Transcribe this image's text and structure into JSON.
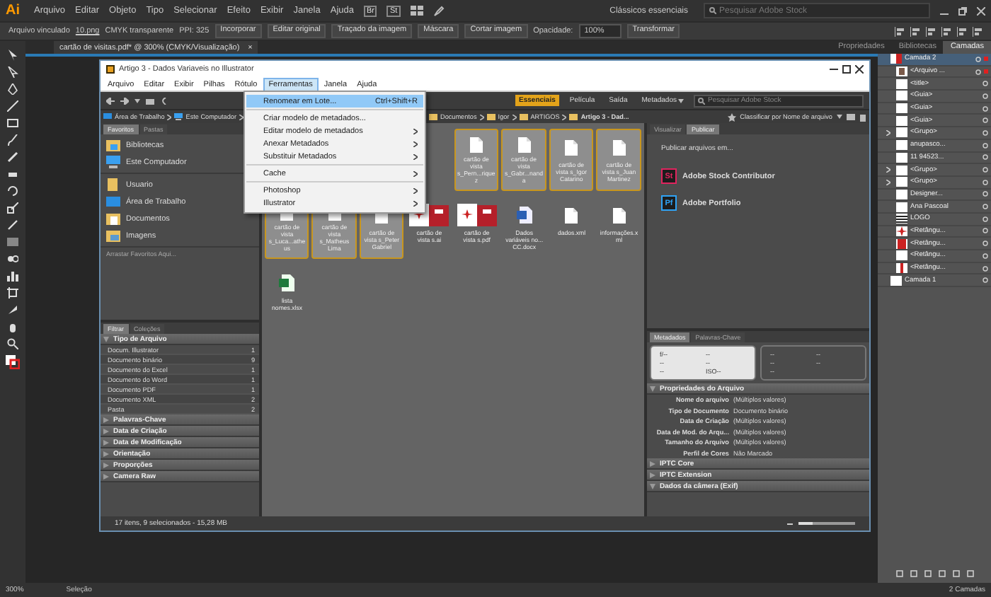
{
  "app": {
    "logo": "Ai",
    "menu": [
      "Arquivo",
      "Editar",
      "Objeto",
      "Tipo",
      "Selecionar",
      "Efeito",
      "Exibir",
      "Janela",
      "Ajuda"
    ],
    "badges": [
      "Br",
      "St"
    ],
    "workspace": "Clássicos essenciais",
    "search_placeholder": "Pesquisar Adobe Stock"
  },
  "control_bar": [
    {
      "kind": "label",
      "text": "Arquivo vinculado"
    },
    {
      "kind": "link",
      "text": "10.png"
    },
    {
      "kind": "label",
      "text": "CMYK transparente"
    },
    {
      "kind": "label",
      "text": "PPI: 325"
    },
    {
      "kind": "button",
      "text": "Incorporar"
    },
    {
      "kind": "button",
      "text": "Editar original"
    },
    {
      "kind": "dropdown",
      "text": "Traçado da imagem"
    },
    {
      "kind": "button",
      "text": "Máscara"
    },
    {
      "kind": "button",
      "text": "Cortar imagem"
    },
    {
      "kind": "label",
      "text": "Opacidade:"
    },
    {
      "kind": "field",
      "text": "100%"
    },
    {
      "kind": "button",
      "text": "Transformar"
    }
  ],
  "document_tab": {
    "title": "cartão de visitas.pdf* @ 300% (CMYK/Visualização)",
    "close": "×"
  },
  "panel_tabs": [
    {
      "label": "Propriedades",
      "selected": false
    },
    {
      "label": "Bibliotecas",
      "selected": false
    },
    {
      "label": "Camadas",
      "selected": true
    }
  ],
  "layers": [
    {
      "name": "Camada 2",
      "kind": "card",
      "selected": true,
      "selected_art": true,
      "children": [
        {
          "name": "<Arquivo ...",
          "kind": "photo",
          "expandable": false,
          "selected_art": true
        },
        {
          "name": "<title>",
          "kind": "blank",
          "expandable": false,
          "selected_art": false
        },
        {
          "name": "<Guia>",
          "kind": "blank",
          "expandable": false,
          "selected_art": false
        },
        {
          "name": "<Guia>",
          "kind": "blank",
          "expandable": false,
          "selected_art": false
        },
        {
          "name": "<Guia>",
          "kind": "blank",
          "expandable": false,
          "selected_art": false
        },
        {
          "name": "<Grupo>",
          "kind": "blank",
          "expandable": true,
          "selected_art": false
        },
        {
          "name": "anupasco...",
          "kind": "blank",
          "expandable": false,
          "selected_art": false
        },
        {
          "name": "11 94523...",
          "kind": "blank",
          "expandable": false,
          "selected_art": false
        },
        {
          "name": "<Grupo>",
          "kind": "blank",
          "expandable": true,
          "selected_art": false
        },
        {
          "name": "<Grupo>",
          "kind": "blank",
          "expandable": true,
          "selected_art": false
        },
        {
          "name": "Designer...",
          "kind": "blank",
          "expandable": false,
          "selected_art": false
        },
        {
          "name": "Ana Pascoal",
          "kind": "blank",
          "expandable": false,
          "selected_art": false
        },
        {
          "name": "LOGO",
          "kind": "lines",
          "expandable": false,
          "selected_art": false
        },
        {
          "name": "<Retângu...",
          "kind": "star",
          "expandable": false,
          "selected_art": false
        },
        {
          "name": "<Retângu...",
          "kind": "bar",
          "expandable": false,
          "selected_art": false
        },
        {
          "name": "<Retângu...",
          "kind": "blank",
          "expandable": false,
          "selected_art": false
        },
        {
          "name": "<Retângu...",
          "kind": "stripe",
          "expandable": false,
          "selected_art": false
        }
      ]
    },
    {
      "name": "Camada 1",
      "kind": "blank",
      "selected": false,
      "selected_art": false
    }
  ],
  "bridge": {
    "title": "Artigo 3 - Dados Variaveis no Illustrator",
    "menu": [
      {
        "label": "Arquivo",
        "selected": false
      },
      {
        "label": "Editar",
        "selected": false
      },
      {
        "label": "Exibir",
        "selected": false
      },
      {
        "label": "Pilhas",
        "selected": false
      },
      {
        "label": "Rótulo",
        "selected": false
      },
      {
        "label": "Ferramentas",
        "selected": true
      },
      {
        "label": "Janela",
        "selected": false
      },
      {
        "label": "Ajuda",
        "selected": false
      }
    ],
    "dropdown": [
      [
        {
          "label": "Renomear em Lote...",
          "shortcut": "Ctrl+Shift+R",
          "submenu": false,
          "highlighted": true
        }
      ],
      [
        {
          "label": "Criar modelo de metadados...",
          "submenu": false,
          "highlighted": false
        },
        {
          "label": "Editar modelo de metadados",
          "submenu": true,
          "highlighted": false
        },
        {
          "label": "Anexar Metadados",
          "submenu": true,
          "highlighted": false
        },
        {
          "label": "Substituir Metadados",
          "submenu": true,
          "highlighted": false
        }
      ],
      [
        {
          "label": "Cache",
          "submenu": true,
          "highlighted": false
        }
      ],
      [
        {
          "label": "Photoshop",
          "submenu": true,
          "highlighted": false
        },
        {
          "label": "Illustrator",
          "submenu": true,
          "highlighted": false
        }
      ]
    ],
    "workspaces": [
      {
        "label": "Essenciais",
        "selected": true
      },
      {
        "label": "Película",
        "selected": false
      },
      {
        "label": "Saída",
        "selected": false
      },
      {
        "label": "Metadados",
        "selected": false
      }
    ],
    "search_placeholder": "Pesquisar Adobe Stock",
    "path_start": [
      "Área de Trabalho",
      "Este Computador"
    ],
    "path_end": [
      "Documentos",
      "Igor",
      "ARTIGOS",
      "Artigo 3 - Dad..."
    ],
    "sort": "Classificar por Nome de arquivo",
    "favorites_tabs": [
      {
        "label": "Favoritos",
        "selected": true
      },
      {
        "label": "Pastas",
        "selected": false
      }
    ],
    "favorites": [
      [
        {
          "label": "Bibliotecas",
          "kind": "library"
        },
        {
          "label": "Este Computador",
          "kind": "computer"
        }
      ],
      [
        {
          "label": "Usuario",
          "kind": "folder"
        },
        {
          "label": "Área de Trabalho",
          "kind": "desktop"
        },
        {
          "label": "Documentos",
          "kind": "documents"
        },
        {
          "label": "Imagens",
          "kind": "images"
        }
      ]
    ],
    "favorites_hint": "Arrastar Favoritos Aqui...",
    "filter_tabs": [
      {
        "label": "Filtrar",
        "selected": true
      },
      {
        "label": "Coleções",
        "selected": false
      }
    ],
    "filters": [
      {
        "title": "Tipo de Arquivo",
        "expanded": true,
        "rows": [
          {
            "label": "Docum. Illustrator",
            "count": "1"
          },
          {
            "label": "Documento binário",
            "count": "9"
          },
          {
            "label": "Documento do Excel",
            "count": "1"
          },
          {
            "label": "Documento do Word",
            "count": "1"
          },
          {
            "label": "Documento PDF",
            "count": "1"
          },
          {
            "label": "Documento XML",
            "count": "2"
          },
          {
            "label": "Pasta",
            "count": "2"
          }
        ]
      },
      {
        "title": "Palavras-Chave",
        "expanded": false
      },
      {
        "title": "Data de Criação",
        "expanded": false
      },
      {
        "title": "Data de Modificação",
        "expanded": false
      },
      {
        "title": "Orientação",
        "expanded": false
      },
      {
        "title": "Proporções",
        "expanded": false
      },
      {
        "title": "Camera Raw",
        "expanded": false
      }
    ],
    "file_rows": [
      [
        {
          "label": "cartão de vista s_Pern...riquez",
          "kind": "document",
          "selected": true
        },
        {
          "label": "cartão de vista s_Gabr...nanda",
          "kind": "document",
          "selected": true
        },
        {
          "label": "cartão de vista s_Igor Catarino",
          "kind": "document",
          "selected": true
        },
        {
          "label": "cartão de vista s_Juan Martinez",
          "kind": "document",
          "selected": true
        }
      ],
      [
        {
          "label": "cartão de vista s_Luca...atheus",
          "kind": "document",
          "selected": true
        },
        {
          "label": "cartão de vista s_Matheus Lima",
          "kind": "document",
          "selected": true
        },
        {
          "label": "cartão de vista s_Peter Gabriel",
          "kind": "document",
          "selected": true
        },
        {
          "label": "cartão de vista s.ai",
          "kind": "artwork",
          "selected": false
        },
        {
          "label": "cartão de vista s.pdf",
          "kind": "artwork",
          "selected": false
        },
        {
          "label": "Dados variáveis no... CC.docx",
          "kind": "word",
          "selected": false
        },
        {
          "label": "dados.xml",
          "kind": "document",
          "selected": false
        },
        {
          "label": "informações.xml",
          "kind": "document",
          "selected": false
        }
      ],
      [
        {
          "label": "lista nomes.xlsx",
          "kind": "excel",
          "selected": false
        }
      ]
    ],
    "preview_tabs": [
      {
        "label": "Visualizar",
        "selected": false
      },
      {
        "label": "Publicar",
        "selected": true
      }
    ],
    "publish_title": "Publicar arquivos em...",
    "services": [
      {
        "badge": "St",
        "name": "Adobe Stock Contributor",
        "color": "#e0245e"
      },
      {
        "badge": "Pf",
        "name": "Adobe Portfolio",
        "color": "#2fa3f5"
      }
    ],
    "metadata_tabs": [
      {
        "label": "Metadados",
        "selected": true
      },
      {
        "label": "Palavras-Chave",
        "selected": false
      }
    ],
    "placard_left": [
      "f/--",
      "--",
      "--",
      "--",
      "--",
      "ISO--"
    ],
    "placard_right": [
      "--",
      "--",
      "--",
      "--",
      "--"
    ],
    "metadata_sections": [
      {
        "title": "Propriedades do Arquivo",
        "expanded": true,
        "rows": [
          {
            "label": "Nome do arquivo",
            "value": "(Múltiplos valores)"
          },
          {
            "label": "Tipo de Documento",
            "value": "Documento binário"
          },
          {
            "label": "Data de Criação",
            "value": "(Múltiplos valores)"
          },
          {
            "label": "Data de Mod. do Arqu...",
            "value": "(Múltiplos valores)"
          },
          {
            "label": "Tamanho do Arquivo",
            "value": "(Múltiplos valores)"
          },
          {
            "label": "Perfil de Cores",
            "value": "Não Marcado"
          }
        ]
      },
      {
        "title": "IPTC Core",
        "expanded": false
      },
      {
        "title": "IPTC Extension",
        "expanded": false
      },
      {
        "title": "Dados da câmera (Exif)",
        "expanded": true
      }
    ],
    "status": "17 itens, 9 selecionados - 15,28 MB",
    "thumb_size": {
      "level": 0.25
    }
  },
  "status_bar": {
    "zoom": "300%",
    "tool": "Seleção",
    "layers": "2 Camadas"
  }
}
